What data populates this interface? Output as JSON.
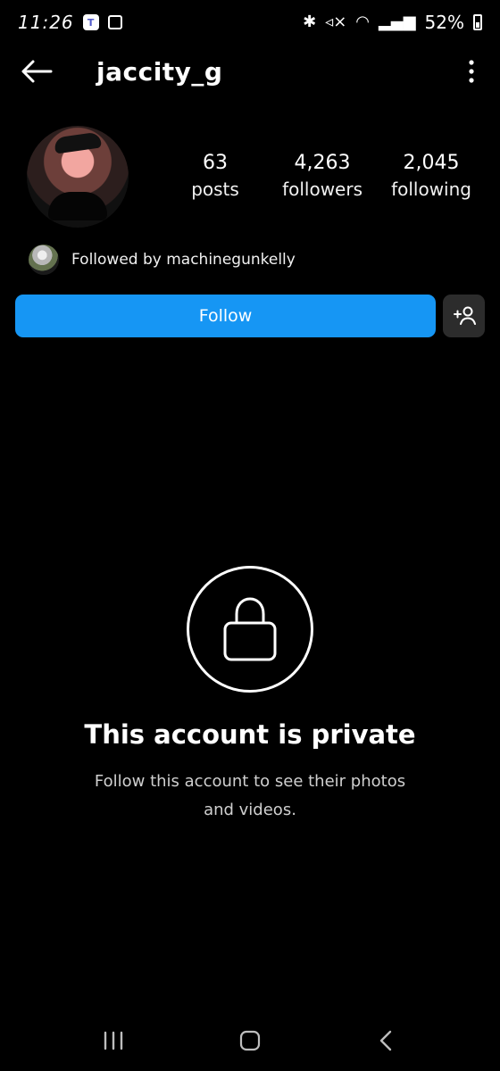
{
  "status": {
    "time": "11:26",
    "battery": "52%"
  },
  "header": {
    "username": "jaccity_g"
  },
  "profile": {
    "stats": [
      {
        "value": "63",
        "label": "posts"
      },
      {
        "value": "4,263",
        "label": "followers"
      },
      {
        "value": "2,045",
        "label": "following"
      }
    ],
    "followed_by": "Followed by machinegunkelly"
  },
  "actions": {
    "follow": "Follow"
  },
  "private": {
    "title": "This account is private",
    "description": "Follow this account to see their photos and videos."
  },
  "icons": {
    "back": "arrow-left-icon",
    "more": "more-vertical-icon",
    "add_person": "add-person-icon",
    "lock": "lock-icon",
    "recent_apps": "recent-apps-icon",
    "home": "home-icon",
    "back_nav": "back-icon"
  },
  "colors": {
    "background": "#000000",
    "primary_button": "#1696F4",
    "secondary_button": "#2C2C2C"
  }
}
